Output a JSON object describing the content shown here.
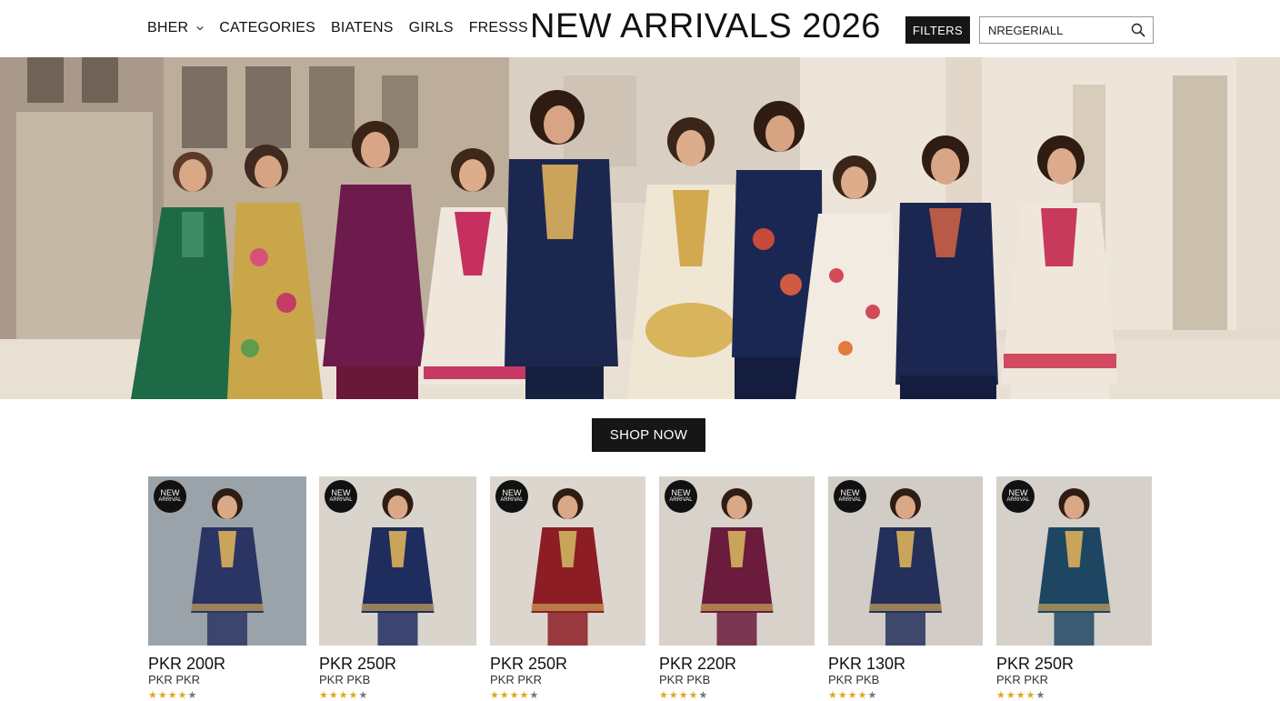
{
  "nav": {
    "items": [
      {
        "label": "BHER",
        "has_dropdown": true
      },
      {
        "label": "CATEGORIES",
        "has_dropdown": false
      },
      {
        "label": "BIATENS",
        "has_dropdown": false
      },
      {
        "label": "GIRLS",
        "has_dropdown": false
      },
      {
        "label": "FRESSS",
        "has_dropdown": false
      }
    ]
  },
  "header": {
    "title": "NEW ARRIVALS 2026",
    "filters_label": "FILTERS",
    "search_value": "NREGERIALL",
    "search_icon": "search-icon"
  },
  "hero": {
    "description_icon": "hero-banner-image"
  },
  "cta": {
    "label": "SHOP NOW"
  },
  "products": [
    {
      "badge_line1": "NEW",
      "badge_line2": "ARRIVAL",
      "price": "PKR 200R",
      "subtitle": "PKR PKR",
      "rating": 4,
      "rating_max": 5,
      "dress_color": "#2a3563",
      "bg_color": "#9aa3aa"
    },
    {
      "badge_line1": "NEW",
      "badge_line2": "ARRIVAL",
      "price": "PKR 250R",
      "subtitle": "PKR PKB",
      "rating": 4,
      "rating_max": 5,
      "dress_color": "#1f2c5e",
      "bg_color": "#d9d4cc"
    },
    {
      "badge_line1": "NEW",
      "badge_line2": "ARRIVAL",
      "price": "PKR 250R",
      "subtitle": "PKR PKR",
      "rating": 4,
      "rating_max": 5,
      "dress_color": "#8c1d24",
      "bg_color": "#dcd6cf"
    },
    {
      "badge_line1": "NEW",
      "badge_line2": "ARRIVAL",
      "price": "PKR 220R",
      "subtitle": "PKR PKB",
      "rating": 4,
      "rating_max": 5,
      "dress_color": "#6b1b3c",
      "bg_color": "#d8d2cb"
    },
    {
      "badge_line1": "NEW",
      "badge_line2": "ARRIVAL",
      "price": "PKR 130R",
      "subtitle": "PKR PKB",
      "rating": 4,
      "rating_max": 5,
      "dress_color": "#24305a",
      "bg_color": "#d2ccc6"
    },
    {
      "badge_line1": "NEW",
      "badge_line2": "ARRIVAL",
      "price": "PKR 250R",
      "subtitle": "PKR PKR",
      "rating": 4,
      "rating_max": 5,
      "dress_color": "#1e4663",
      "bg_color": "#d5d0ca"
    }
  ]
}
